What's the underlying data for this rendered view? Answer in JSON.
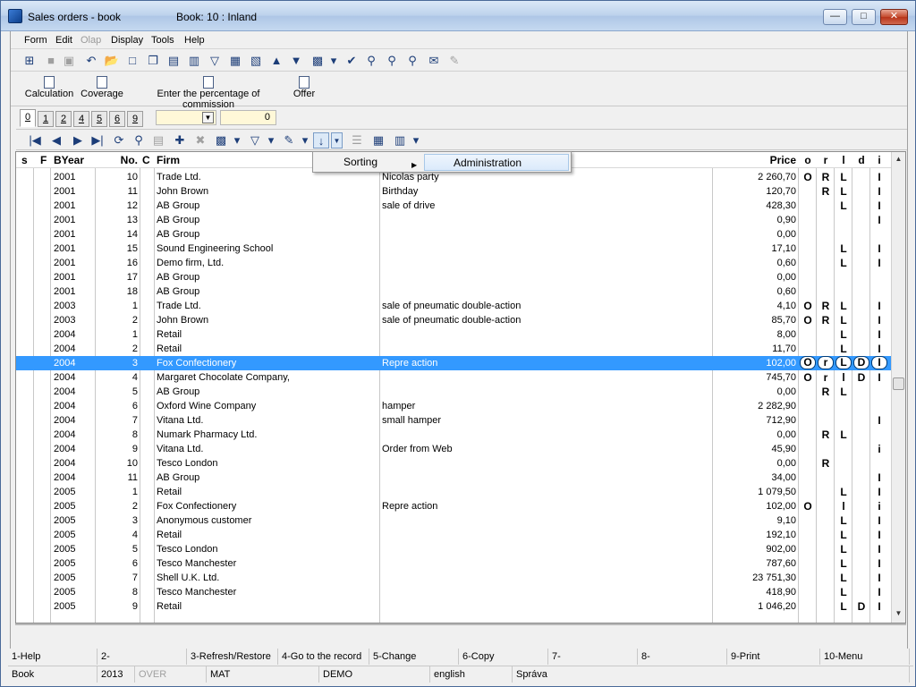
{
  "window": {
    "title": "Sales orders - book",
    "book": "Book: 10 : Inland",
    "min_label": "—",
    "max_label": "□",
    "close_label": "✕"
  },
  "menu": [
    "Form",
    "Edit",
    "Olap",
    "Display",
    "Tools",
    "Help"
  ],
  "toolbar2": [
    "Calculation",
    "Coverage",
    "Enter the percentage of commission",
    "Offer"
  ],
  "tabs": [
    "0",
    "1",
    "2",
    "4",
    "5",
    "6",
    "9"
  ],
  "combo": {
    "value": "",
    "dropdown": "▼"
  },
  "counter": "0",
  "context_menu": {
    "sorting": "Sorting",
    "administration": "Administration",
    "arrow": "▶"
  },
  "headers": {
    "s": "s",
    "F": "F",
    "BYear": "BYear",
    "No": "No.",
    "C": "C",
    "Firm": "Firm",
    "Price": "Price",
    "o": "o",
    "r": "r",
    "l": "l",
    "d": "d",
    "i": "i"
  },
  "rows": [
    {
      "year": "2001",
      "no": "10",
      "firm": "Trade Ltd.",
      "desc": "Nicolas party",
      "price": "2 260,70",
      "o": "O",
      "r": "R",
      "l": "L",
      "d": "",
      "i": "I"
    },
    {
      "year": "2001",
      "no": "11",
      "firm": "John Brown",
      "desc": "Birthday",
      "price": "120,70",
      "o": "",
      "r": "R",
      "l": "L",
      "d": "",
      "i": "I"
    },
    {
      "year": "2001",
      "no": "12",
      "firm": "AB Group",
      "desc": "sale of drive",
      "price": "428,30",
      "o": "",
      "r": "",
      "l": "L",
      "d": "",
      "i": "I"
    },
    {
      "year": "2001",
      "no": "13",
      "firm": "AB Group",
      "desc": "",
      "price": "0,90",
      "o": "",
      "r": "",
      "l": "",
      "d": "",
      "i": "I"
    },
    {
      "year": "2001",
      "no": "14",
      "firm": "AB Group",
      "desc": "",
      "price": "0,00",
      "o": "",
      "r": "",
      "l": "",
      "d": "",
      "i": ""
    },
    {
      "year": "2001",
      "no": "15",
      "firm": "Sound Engineering School",
      "desc": "",
      "price": "17,10",
      "o": "",
      "r": "",
      "l": "L",
      "d": "",
      "i": "I"
    },
    {
      "year": "2001",
      "no": "16",
      "firm": "Demo firm, Ltd.",
      "desc": "",
      "price": "0,60",
      "o": "",
      "r": "",
      "l": "L",
      "d": "",
      "i": "I"
    },
    {
      "year": "2001",
      "no": "17",
      "firm": "AB Group",
      "desc": "",
      "price": "0,00",
      "o": "",
      "r": "",
      "l": "",
      "d": "",
      "i": ""
    },
    {
      "year": "2001",
      "no": "18",
      "firm": "AB Group",
      "desc": "",
      "price": "0,60",
      "o": "",
      "r": "",
      "l": "",
      "d": "",
      "i": ""
    },
    {
      "year": "2003",
      "no": "1",
      "firm": "Trade Ltd.",
      "desc": "sale of pneumatic double-action",
      "price": "4,10",
      "o": "O",
      "r": "R",
      "l": "L",
      "d": "",
      "i": "I"
    },
    {
      "year": "2003",
      "no": "2",
      "firm": "John Brown",
      "desc": "sale of pneumatic double-action",
      "price": "85,70",
      "o": "O",
      "r": "R",
      "l": "L",
      "d": "",
      "i": "I"
    },
    {
      "year": "2004",
      "no": "1",
      "firm": "Retail",
      "desc": "",
      "price": "8,00",
      "o": "",
      "r": "",
      "l": "L",
      "d": "",
      "i": "I"
    },
    {
      "year": "2004",
      "no": "2",
      "firm": "Retail",
      "desc": "",
      "price": "11,70",
      "o": "",
      "r": "",
      "l": "L",
      "d": "",
      "i": "I"
    },
    {
      "year": "2004",
      "no": "3",
      "firm": "Fox Confectionery",
      "desc": "Repre action",
      "price": "102,00",
      "o": "O",
      "r": "r",
      "l": "L",
      "d": "D",
      "i": "I",
      "selected": true
    },
    {
      "year": "2004",
      "no": "4",
      "firm": "Margaret Chocolate Company,",
      "desc": "",
      "price": "745,70",
      "o": "O",
      "r": "r",
      "l": "l",
      "d": "D",
      "i": "I"
    },
    {
      "year": "2004",
      "no": "5",
      "firm": "AB Group",
      "desc": "",
      "price": "0,00",
      "o": "",
      "r": "R",
      "l": "L",
      "d": "",
      "i": ""
    },
    {
      "year": "2004",
      "no": "6",
      "firm": "Oxford Wine Company",
      "desc": "hamper",
      "price": "2 282,90",
      "o": "",
      "r": "",
      "l": "",
      "d": "",
      "i": ""
    },
    {
      "year": "2004",
      "no": "7",
      "firm": "Vitana Ltd.",
      "desc": "small hamper",
      "price": "712,90",
      "o": "",
      "r": "",
      "l": "",
      "d": "",
      "i": "I"
    },
    {
      "year": "2004",
      "no": "8",
      "firm": "Numark Pharmacy Ltd.",
      "desc": "",
      "price": "0,00",
      "o": "",
      "r": "R",
      "l": "L",
      "d": "",
      "i": ""
    },
    {
      "year": "2004",
      "no": "9",
      "firm": "Vitana Ltd.",
      "desc": "Order from Web",
      "price": "45,90",
      "o": "",
      "r": "",
      "l": "",
      "d": "",
      "i": "i"
    },
    {
      "year": "2004",
      "no": "10",
      "firm": "Tesco London",
      "desc": "",
      "price": "0,00",
      "o": "",
      "r": "R",
      "l": "",
      "d": "",
      "i": ""
    },
    {
      "year": "2004",
      "no": "11",
      "firm": "AB Group",
      "desc": "",
      "price": "34,00",
      "o": "",
      "r": "",
      "l": "",
      "d": "",
      "i": "I"
    },
    {
      "year": "2005",
      "no": "1",
      "firm": "Retail",
      "desc": "",
      "price": "1 079,50",
      "o": "",
      "r": "",
      "l": "L",
      "d": "",
      "i": "I"
    },
    {
      "year": "2005",
      "no": "2",
      "firm": "Fox Confectionery",
      "desc": "Repre action",
      "price": "102,00",
      "o": "O",
      "r": "",
      "l": "l",
      "d": "",
      "i": "i"
    },
    {
      "year": "2005",
      "no": "3",
      "firm": "Anonymous customer",
      "desc": "",
      "price": "9,10",
      "o": "",
      "r": "",
      "l": "L",
      "d": "",
      "i": "I"
    },
    {
      "year": "2005",
      "no": "4",
      "firm": "Retail",
      "desc": "",
      "price": "192,10",
      "o": "",
      "r": "",
      "l": "L",
      "d": "",
      "i": "I"
    },
    {
      "year": "2005",
      "no": "5",
      "firm": "Tesco London",
      "desc": "",
      "price": "902,00",
      "o": "",
      "r": "",
      "l": "L",
      "d": "",
      "i": "I"
    },
    {
      "year": "2005",
      "no": "6",
      "firm": "Tesco Manchester",
      "desc": "",
      "price": "787,60",
      "o": "",
      "r": "",
      "l": "L",
      "d": "",
      "i": "I"
    },
    {
      "year": "2005",
      "no": "7",
      "firm": "Shell U.K. Ltd.",
      "desc": "",
      "price": "23 751,30",
      "o": "",
      "r": "",
      "l": "L",
      "d": "",
      "i": "I"
    },
    {
      "year": "2005",
      "no": "8",
      "firm": "Tesco Manchester",
      "desc": "",
      "price": "418,90",
      "o": "",
      "r": "",
      "l": "L",
      "d": "",
      "i": "I"
    },
    {
      "year": "2005",
      "no": "9",
      "firm": "Retail",
      "desc": "",
      "price": "1 046,20",
      "o": "",
      "r": "",
      "l": "L",
      "d": "D",
      "i": "I"
    }
  ],
  "fkeys": [
    "1-Help",
    "2-",
    "3-Refresh/Restore",
    "4-Go to the record",
    "5-Change",
    "6-Copy",
    "7-",
    "8-",
    "9-Print",
    "10-Menu"
  ],
  "status": [
    "Book",
    "2013",
    "OVER",
    "MAT",
    "DEMO",
    "english",
    "Správa"
  ],
  "scroll": {
    "up": "▲",
    "down": "▼"
  },
  "icons": {
    "tree": "⊞",
    "save": "■",
    "save_as": "▣",
    "undo": "↶",
    "open": "📂",
    "new": "□",
    "copy": "❐",
    "paste": "▤",
    "book": "▥",
    "filter": "▽",
    "doc": "▦",
    "stack": "▧",
    "up": "▲",
    "down": "▼",
    "camera": "▩",
    "down_small": "▾",
    "check": "✔",
    "binoc": "⚲",
    "binoc2": "⚲",
    "binoc3": "⚲",
    "mail": "✉",
    "disabled": "✎",
    "first": "|◀",
    "prev": "◀",
    "next": "▶",
    "last": "▶|",
    "refresh": "⟳",
    "find": "⚲",
    "print": "▤",
    "add": "✚",
    "del": "✖",
    "cam": "▩",
    "funnel": "▽",
    "edit": "✎",
    "sort": "↓",
    "sortdd": "▼",
    "list": "☰",
    "xls": "▦",
    "grid": "▥"
  }
}
